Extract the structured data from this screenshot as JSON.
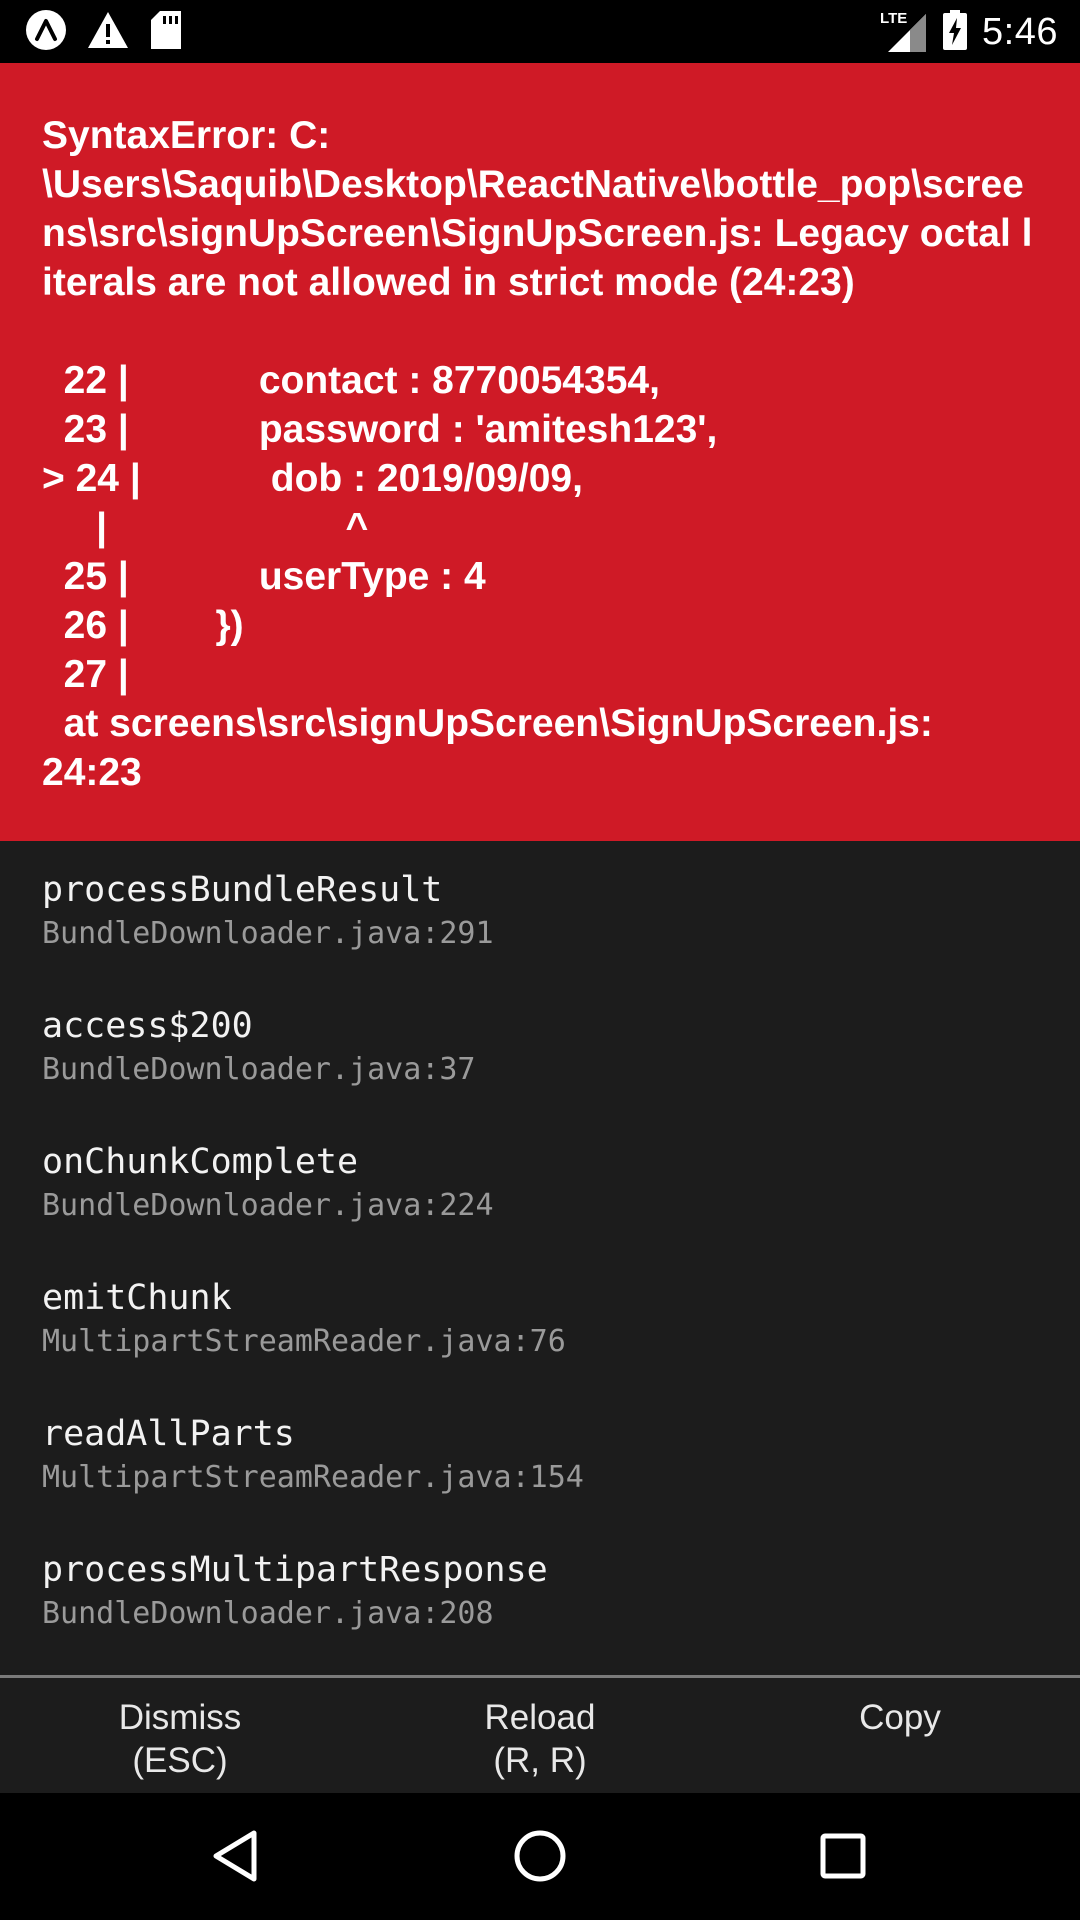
{
  "status_bar": {
    "time": "5:46",
    "network": "LTE",
    "left_icons": [
      "expo-icon",
      "warning-icon",
      "sd-card-icon"
    ],
    "right_icons": [
      "lte-signal-icon",
      "battery-charging-icon"
    ]
  },
  "error": {
    "message": "SyntaxError: C:\n\\Users\\Saquib\\Desktop\\ReactNative\\bottle_pop\\screens\\src\\signUpScreen\\SignUpScreen.js: Legacy octal literals are not allowed in strict mode (24:23)",
    "code_frame": [
      "  22 |            contact : 8770054354,",
      "  23 |            password : 'amitesh123',",
      "> 24 |            dob : 2019/09/09,",
      "     |                      ^",
      "  25 |            userType : 4",
      "  26 |        })",
      "  27 |"
    ],
    "location": "  at screens\\src\\signUpScreen\\SignUpScreen.js:\n24:23",
    "background_color": "#cf1a26"
  },
  "stack_trace": [
    {
      "method": "processBundleResult",
      "file": "BundleDownloader.java:291"
    },
    {
      "method": "access$200",
      "file": "BundleDownloader.java:37"
    },
    {
      "method": "onChunkComplete",
      "file": "BundleDownloader.java:224"
    },
    {
      "method": "emitChunk",
      "file": "MultipartStreamReader.java:76"
    },
    {
      "method": "readAllParts",
      "file": "MultipartStreamReader.java:154"
    },
    {
      "method": "processMultipartResponse",
      "file": "BundleDownloader.java:208"
    }
  ],
  "buttons": {
    "dismiss": {
      "line1": "Dismiss",
      "line2": "(ESC)"
    },
    "reload": {
      "line1": "Reload",
      "line2": "(R, R)"
    },
    "copy": {
      "line1": "Copy",
      "line2": ""
    }
  },
  "nav_bar": {
    "icons": [
      "back-icon",
      "home-icon",
      "recents-icon"
    ]
  }
}
